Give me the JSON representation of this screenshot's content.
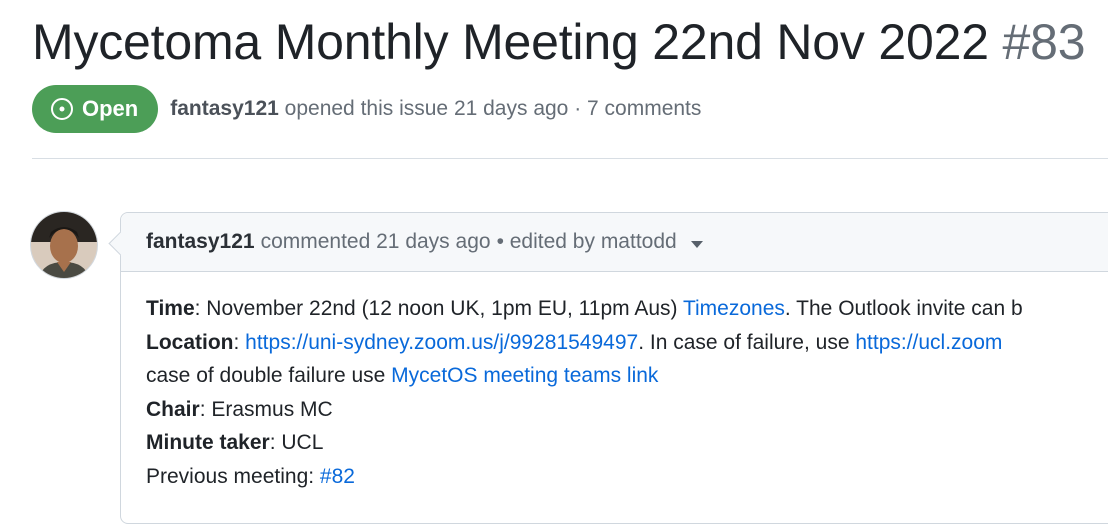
{
  "issue": {
    "title": "Mycetoma Monthly Meeting 22nd Nov 2022",
    "number": "#83",
    "state": "Open",
    "author": "fantasy121",
    "opened_text": "opened this issue 21 days ago · 7 comments",
    "accent_open": "#4c9e57"
  },
  "comment": {
    "author": "fantasy121",
    "action": "commented 21 days ago",
    "edited": "• edited by mattodd",
    "time_label": "Time",
    "time_value": ": November 22nd (12 noon UK, 1pm EU, 11pm Aus) ",
    "time_link": "Timezones",
    "time_tail": ". The Outlook invite can b",
    "location_label": "Location",
    "location_sep": ": ",
    "location_link": "https://uni-sydney.zoom.us/j/99281549497",
    "location_mid": ". In case of failure, use ",
    "location_link2": "https://ucl.zoom",
    "line3_text": "case of double failure use ",
    "line3_link": "MycetOS meeting teams link",
    "chair_label": "Chair",
    "chair_value": ": Erasmus MC",
    "minute_label": "Minute taker",
    "minute_value": ": UCL",
    "previous_text": "Previous meeting: ",
    "previous_link": "#82"
  }
}
